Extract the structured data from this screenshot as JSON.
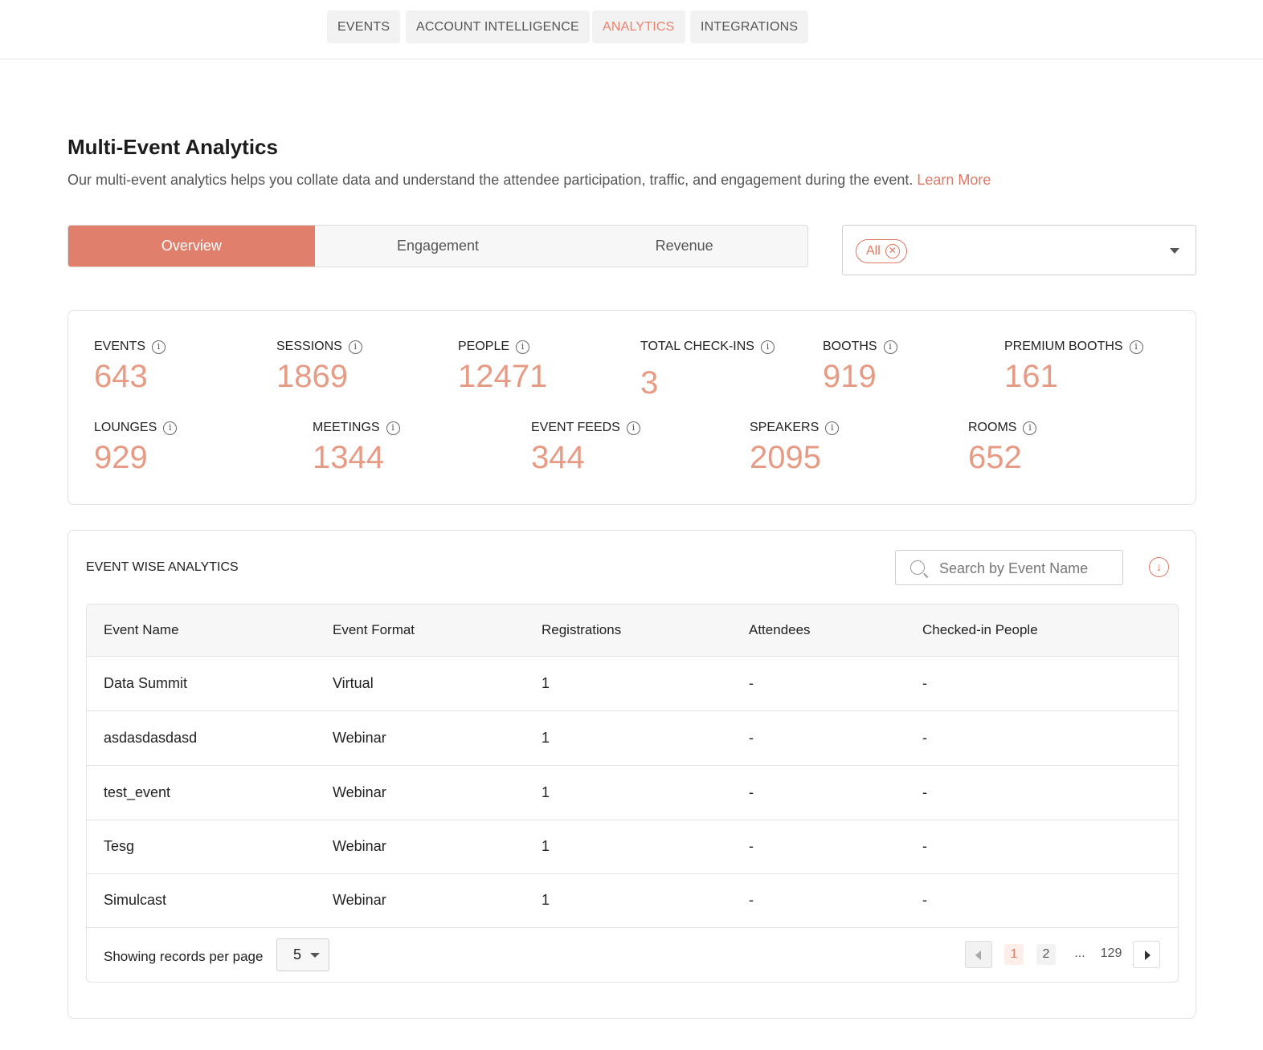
{
  "topnav": {
    "tabs": [
      {
        "label": "EVENTS"
      },
      {
        "label": "ACCOUNT INTELLIGENCE"
      },
      {
        "label": "ANALYTICS"
      },
      {
        "label": "INTEGRATIONS"
      }
    ],
    "active": "ANALYTICS"
  },
  "header": {
    "title": "Multi-Event Analytics",
    "description": "Our multi-event analytics helps you collate data and understand the attendee participation, traffic, and engagement during the event.",
    "learn_more": "Learn More"
  },
  "segment": {
    "items": [
      {
        "label": "Overview"
      },
      {
        "label": "Engagement"
      },
      {
        "label": "Revenue"
      }
    ],
    "active": "Overview"
  },
  "filter": {
    "chip_label": "All"
  },
  "stats": {
    "events": {
      "label": "EVENTS",
      "value": "643"
    },
    "sessions": {
      "label": "SESSIONS",
      "value": "1869"
    },
    "people": {
      "label": "PEOPLE",
      "value": "12471"
    },
    "checkins": {
      "label": "TOTAL CHECK-INS",
      "value": "3"
    },
    "booths": {
      "label": "BOOTHS",
      "value": "919"
    },
    "premium_booths": {
      "label": "PREMIUM BOOTHS",
      "value": "161"
    },
    "lounges": {
      "label": "LOUNGES",
      "value": "929"
    },
    "meetings": {
      "label": "MEETINGS",
      "value": "1344"
    },
    "event_feeds": {
      "label": "EVENT FEEDS",
      "value": "344"
    },
    "speakers": {
      "label": "SPEAKERS",
      "value": "2095"
    },
    "rooms": {
      "label": "ROOMS",
      "value": "652"
    }
  },
  "event_table": {
    "title": "EVENT WISE ANALYTICS",
    "search_placeholder": "Search by Event Name",
    "columns": [
      "Event Name",
      "Event Format",
      "Registrations",
      "Attendees",
      "Checked-in People"
    ],
    "rows": [
      [
        "Data Summit",
        "Virtual",
        "1",
        "-",
        "-"
      ],
      [
        "asdasdasdasd",
        "Webinar",
        "1",
        "-",
        "-"
      ],
      [
        "test_event",
        "Webinar",
        "1",
        "-",
        "-"
      ],
      [
        "Tesg",
        "Webinar",
        "1",
        "-",
        "-"
      ],
      [
        "Simulcast",
        "Webinar",
        "1",
        "-",
        "-"
      ]
    ],
    "per_page_label": "Showing records per page",
    "per_page_value": "5",
    "pagination": {
      "current": "1",
      "second": "2",
      "ellipsis": "...",
      "last": "129"
    }
  },
  "colors": {
    "accent": "#e07f6c",
    "stat_value": "#e89b84"
  }
}
